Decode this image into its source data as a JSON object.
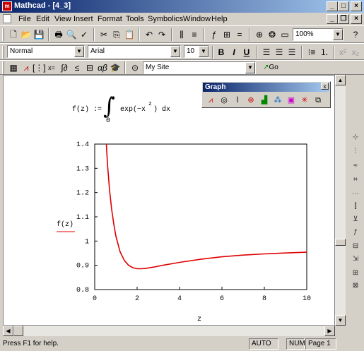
{
  "window": {
    "title": "Mathcad - [4_3]",
    "min": "_",
    "max": "□",
    "close": "×"
  },
  "menu": [
    "File",
    "Edit",
    "View",
    "Insert",
    "Format",
    "Tools",
    "Symbolics",
    "Window",
    "Help"
  ],
  "toolbar": {
    "zoom": "100%"
  },
  "formatbar": {
    "style": "Normal",
    "font": "Arial",
    "size": "10",
    "bold": "B",
    "italic": "I",
    "underline": "U"
  },
  "mathbar": {
    "site": "My Site",
    "go": "Go"
  },
  "graph_palette": {
    "title": "Graph",
    "close": "x"
  },
  "formula": {
    "lhs": "f(z) :=",
    "upper": "∞",
    "lower": "0",
    "integrand": "exp(−x",
    "exponent": "z",
    "close": ")",
    "dx": "dx"
  },
  "plot": {
    "ylabel": "f(z)",
    "xlabel": "z"
  },
  "chart_data": {
    "type": "line",
    "x_ticks": [
      "0",
      "2",
      "4",
      "6",
      "8",
      "10"
    ],
    "y_ticks": [
      "0.8",
      "0.9",
      "1",
      "1.1",
      "1.2",
      "1.3",
      "1.4"
    ],
    "xlim": [
      0,
      10
    ],
    "ylim": [
      0.8,
      1.4
    ],
    "grid": false,
    "series": [
      {
        "color": "#e00000",
        "x": [
          0.55,
          0.6,
          0.7,
          0.8,
          0.9,
          1.0,
          1.2,
          1.4,
          1.6,
          1.8,
          2.0,
          2.2,
          2.4,
          2.8,
          3.2,
          4.0,
          5.0,
          6.0,
          7.0,
          8.0,
          9.0,
          10.0
        ],
        "y": [
          1.4,
          1.32,
          1.21,
          1.13,
          1.07,
          1.02,
          0.955,
          0.92,
          0.9,
          0.89,
          0.886,
          0.886,
          0.887,
          0.893,
          0.9,
          0.912,
          0.925,
          0.935,
          0.942,
          0.947,
          0.951,
          0.954
        ]
      }
    ]
  },
  "status": {
    "help": "Press F1 for help.",
    "mode": "AUTO",
    "num": "NUM",
    "page": "Page 1"
  }
}
